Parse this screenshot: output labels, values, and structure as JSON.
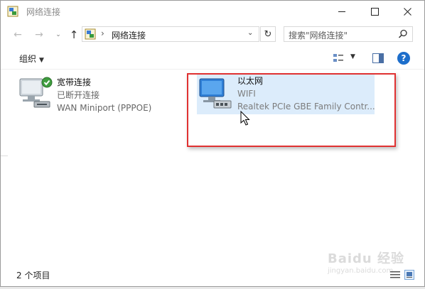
{
  "window": {
    "title": "网络连接",
    "icons": {
      "app": "network-connections-icon",
      "minimize": "minimize-icon",
      "maximize": "maximize-icon",
      "close": "close-icon"
    }
  },
  "toolbar": {
    "back_icon": "back-arrow-icon",
    "forward_icon": "forward-arrow-icon",
    "recent_icon": "chevron-down-icon",
    "up_icon": "up-arrow-icon",
    "address": {
      "separator": "›",
      "crumb": "网络连接"
    },
    "refresh_icon": "refresh-icon",
    "search": {
      "placeholder": "搜索\"网络连接\""
    }
  },
  "commandbar": {
    "organize_label": "组织",
    "organize_caret": "▼",
    "view_icon": "change-view-icon",
    "preview_icon": "preview-pane-icon",
    "help_label": "?"
  },
  "items": [
    {
      "name": "宽带连接",
      "status": "已断开连接",
      "device": "WAN Miniport (PPPOE)",
      "icon": "dialup-connection-icon",
      "badge": "check-badge-icon"
    },
    {
      "name": "以太网",
      "status": "WIFI",
      "device": "Realtek PCIe GBE Family Contr...",
      "icon": "ethernet-connection-icon",
      "selected": true
    }
  ],
  "statusbar": {
    "count": "2 个项目"
  },
  "watermark": {
    "logo": "Baidu 经验",
    "url": "jingyan.baidu.com"
  },
  "colors": {
    "selection": "#dcecfb",
    "annotation": "#e03131",
    "help": "#1d6ecb"
  }
}
